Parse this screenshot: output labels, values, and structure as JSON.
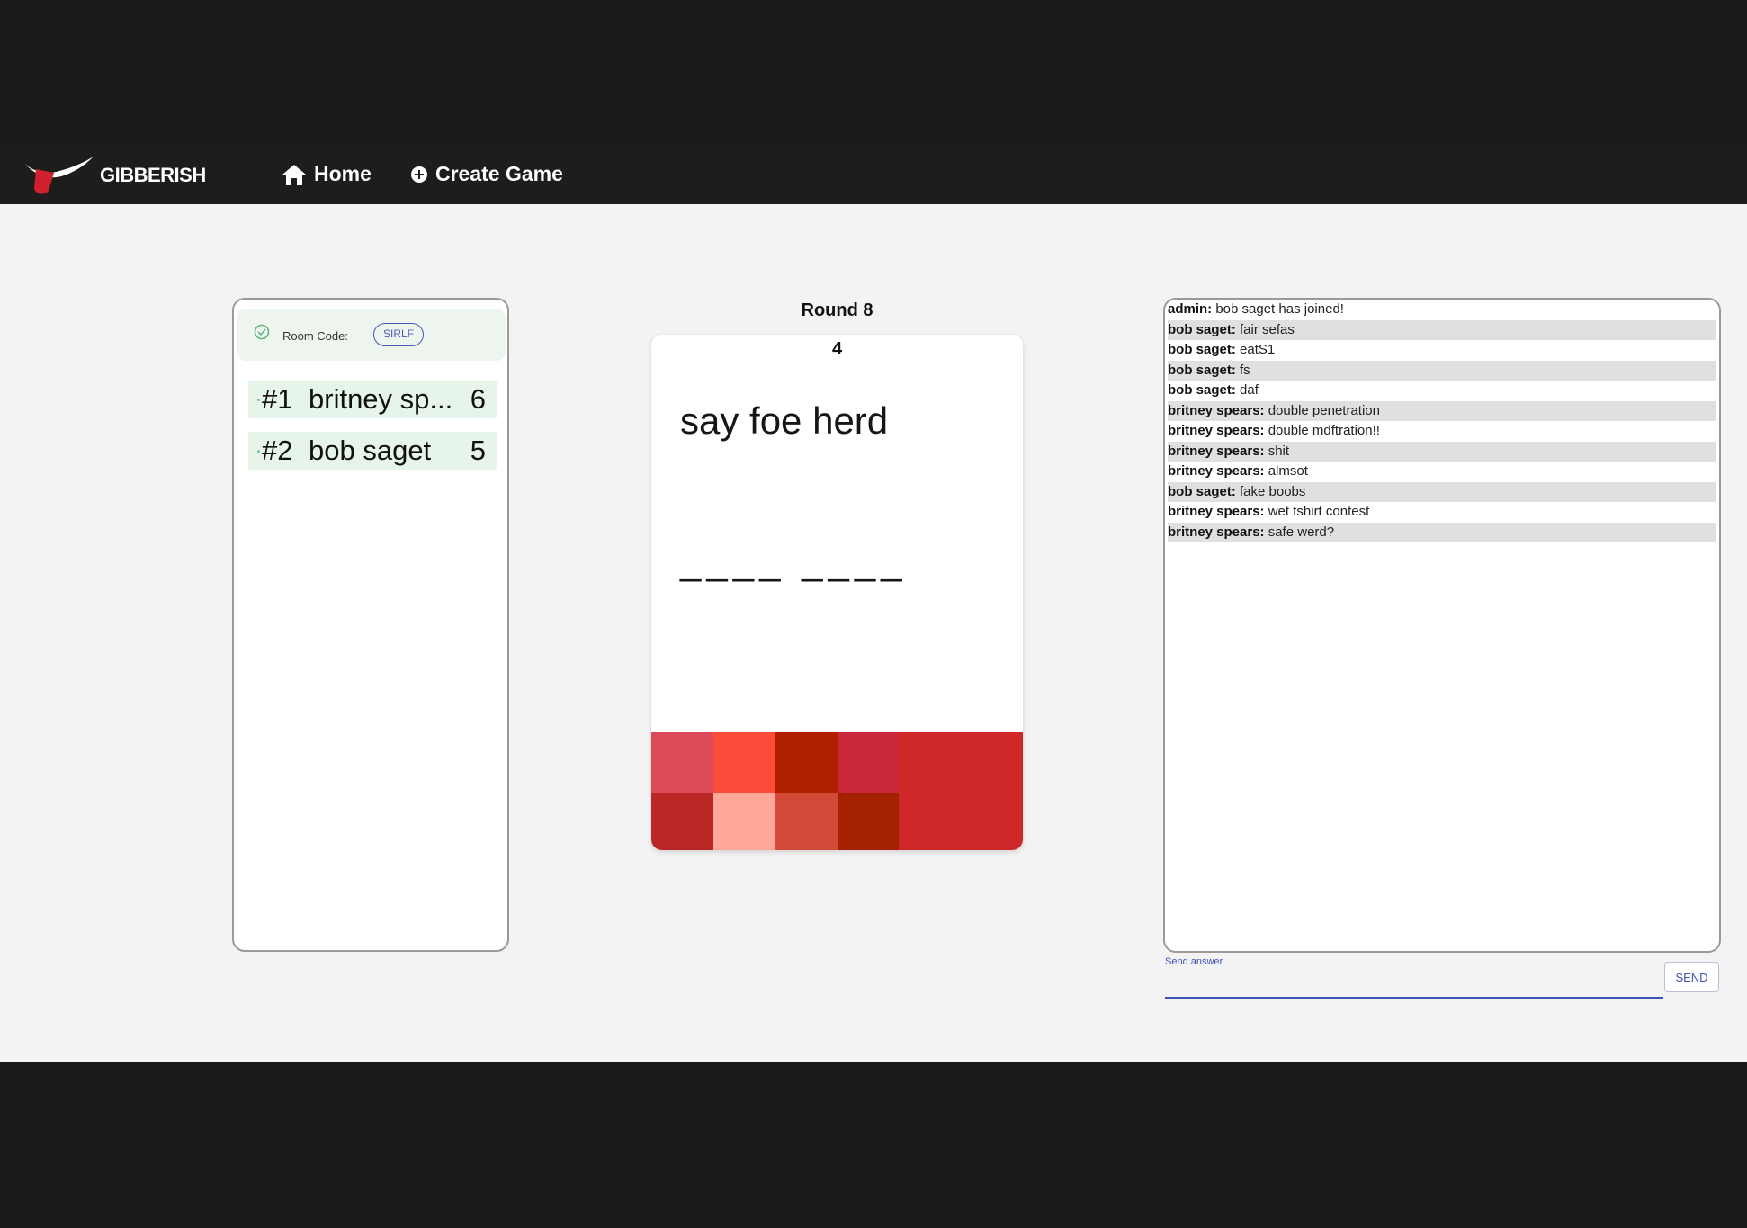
{
  "nav": {
    "brand": "GIBBERISH",
    "home": "Home",
    "create_game": "Create Game"
  },
  "room": {
    "label": "Room Code:",
    "code": "SIRLF"
  },
  "players": [
    {
      "rank": "#1",
      "name": "britney sp...",
      "score": "6"
    },
    {
      "rank": "#2",
      "name": "bob saget",
      "score": "5"
    }
  ],
  "game": {
    "round": "Round 8",
    "timer": "4",
    "phrase": "say foe herd",
    "blanks": "____ ____"
  },
  "tile_colors": [
    "#dc4a58",
    "#fb4c3a",
    "#b02000",
    "#c9283b",
    "#cf2627",
    "#bb2727",
    "#ffa899",
    "#d44a38",
    "#a42200"
  ],
  "chat": [
    {
      "user": "admin:",
      "text": " bob saget has joined!"
    },
    {
      "user": "bob saget:",
      "text": " fair sefas"
    },
    {
      "user": "bob saget:",
      "text": " eatS1"
    },
    {
      "user": "bob saget:",
      "text": " fs"
    },
    {
      "user": "bob saget:",
      "text": " daf"
    },
    {
      "user": "britney spears:",
      "text": " double penetration"
    },
    {
      "user": "britney spears:",
      "text": " double mdftration!!"
    },
    {
      "user": "britney spears:",
      "text": " shit"
    },
    {
      "user": "britney spears:",
      "text": " almsot"
    },
    {
      "user": "bob saget:",
      "text": " fake boobs"
    },
    {
      "user": "britney spears:",
      "text": " wet tshirt contest"
    },
    {
      "user": "britney spears:",
      "text": " safe werd?"
    }
  ],
  "answer": {
    "label": "Send answer",
    "value": "",
    "send": "SEND"
  }
}
